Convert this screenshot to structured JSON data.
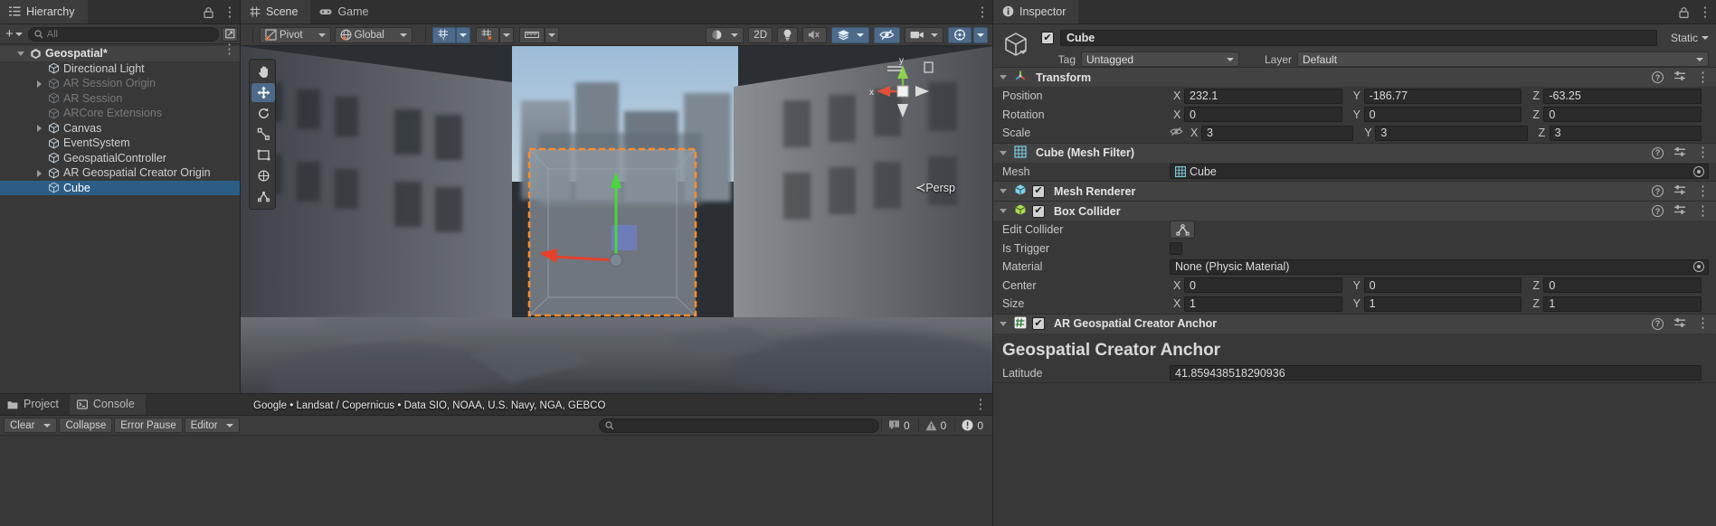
{
  "hierarchy": {
    "tab_label": "Hierarchy",
    "add_label": "+",
    "search_placeholder": "All",
    "items": [
      {
        "label": "Geospatial*",
        "depth": 0,
        "twisty": "open",
        "selected": false,
        "dim": false,
        "root": true
      },
      {
        "label": "Directional Light",
        "depth": 1,
        "twisty": "none",
        "selected": false,
        "dim": false,
        "root": false
      },
      {
        "label": "AR Session Origin",
        "depth": 1,
        "twisty": "closed",
        "selected": false,
        "dim": true,
        "root": false
      },
      {
        "label": "AR Session",
        "depth": 1,
        "twisty": "none",
        "selected": false,
        "dim": true,
        "root": false
      },
      {
        "label": "ARCore Extensions",
        "depth": 1,
        "twisty": "none",
        "selected": false,
        "dim": true,
        "root": false
      },
      {
        "label": "Canvas",
        "depth": 1,
        "twisty": "closed",
        "selected": false,
        "dim": false,
        "root": false
      },
      {
        "label": "EventSystem",
        "depth": 1,
        "twisty": "none",
        "selected": false,
        "dim": false,
        "root": false
      },
      {
        "label": "GeospatialController",
        "depth": 1,
        "twisty": "none",
        "selected": false,
        "dim": false,
        "root": false
      },
      {
        "label": "AR Geospatial Creator Origin",
        "depth": 1,
        "twisty": "closed",
        "selected": false,
        "dim": false,
        "root": false
      },
      {
        "label": "Cube",
        "depth": 1,
        "twisty": "none",
        "selected": true,
        "dim": false,
        "root": false
      }
    ]
  },
  "scene": {
    "tabs": [
      {
        "label": "Scene",
        "icon": "grid-icon",
        "active": true
      },
      {
        "label": "Game",
        "icon": "gamepad-icon",
        "active": false
      }
    ],
    "toolbar": {
      "pivot_label": "Pivot",
      "global_label": "Global",
      "grid_icon": "grid-axis-icon",
      "snap_icon": "snap-magnet-icon",
      "ruler_icon": "ruler-icon",
      "shading_icon": "shading-sphere-icon",
      "twod_label": "2D",
      "light_icon": "light-bulb-icon",
      "audio_icon": "audio-mute-icon",
      "fx_icon": "effects-icon",
      "hidden_icon": "visibility-off-icon",
      "camera_icon": "camera-icon",
      "gizmos_icon": "gizmos-icon"
    },
    "tools": [
      {
        "name": "hand-tool",
        "active": false
      },
      {
        "name": "move-tool",
        "active": true
      },
      {
        "name": "rotate-tool",
        "active": false
      },
      {
        "name": "scale-tool",
        "active": false
      },
      {
        "name": "rect-tool",
        "active": false
      },
      {
        "name": "transform-tool",
        "active": false
      },
      {
        "name": "custom-tool",
        "active": false
      }
    ],
    "gizmo": {
      "x_label": "x",
      "y_label": "y"
    },
    "perspective_label": "Persp",
    "attribution": "Google • Landsat / Copernicus • Data SIO, NOAA, U.S. Navy, NGA, GEBCO"
  },
  "inspector": {
    "tab_label": "Inspector",
    "object_name": "Cube",
    "enabled": true,
    "static_label": "Static",
    "tag_label": "Tag",
    "tag_value": "Untagged",
    "layer_label": "Layer",
    "layer_value": "Default",
    "components": [
      {
        "title": "Transform",
        "icon": "transform-icon",
        "has_checkbox": false,
        "rows": [
          {
            "label": "Position",
            "type": "vec3",
            "x": "232.1",
            "y": "-186.77",
            "z": "-63.25",
            "lock": false
          },
          {
            "label": "Rotation",
            "type": "vec3",
            "x": "0",
            "y": "0",
            "z": "0",
            "lock": false
          },
          {
            "label": "Scale",
            "type": "vec3",
            "x": "3",
            "y": "3",
            "z": "3",
            "lock": true
          }
        ]
      },
      {
        "title": "Cube (Mesh Filter)",
        "icon": "mesh-filter-icon",
        "has_checkbox": false,
        "rows": [
          {
            "label": "Mesh",
            "type": "object",
            "value": "Cube",
            "value_icon": "mesh-icon"
          }
        ]
      },
      {
        "title": "Mesh Renderer",
        "icon": "mesh-renderer-icon",
        "has_checkbox": true,
        "collapsed": true,
        "rows": []
      },
      {
        "title": "Box Collider",
        "icon": "box-collider-icon",
        "has_checkbox": true,
        "rows": [
          {
            "label": "Edit Collider",
            "type": "button",
            "button_icon": "edit-collider-icon"
          },
          {
            "label": "Is Trigger",
            "type": "checkbox",
            "checked": false
          },
          {
            "label": "Material",
            "type": "object",
            "value": "None (Physic Material)",
            "value_icon": ""
          },
          {
            "label": "Center",
            "type": "vec3",
            "x": "0",
            "y": "0",
            "z": "0",
            "lock": false
          },
          {
            "label": "Size",
            "type": "vec3",
            "x": "1",
            "y": "1",
            "z": "1",
            "lock": false
          }
        ]
      },
      {
        "title": "AR Geospatial Creator Anchor",
        "icon": "hash-icon",
        "has_checkbox": true,
        "big_title": "Geospatial Creator Anchor",
        "rows": [
          {
            "label": "Latitude",
            "type": "text",
            "value": "41.859438518290936"
          }
        ]
      }
    ]
  },
  "bottom": {
    "tabs": [
      {
        "label": "Project",
        "icon": "project-icon",
        "active": false
      },
      {
        "label": "Console",
        "icon": "console-icon",
        "active": true
      }
    ],
    "toolbar": {
      "clear_label": "Clear",
      "collapse_label": "Collapse",
      "error_pause_label": "Error Pause",
      "editor_label": "Editor",
      "search_placeholder": ""
    },
    "counts": {
      "log": "0",
      "warning": "0",
      "error": "0"
    }
  },
  "colors": {
    "accent_blue": "#4d6a8a",
    "selection_blue": "#2c5d87",
    "panel_bg": "#383838",
    "header_bg": "#3c3c3c",
    "component_bg": "#424242",
    "field_bg": "#2a2a2a",
    "outline_orange": "#ff8c2b"
  }
}
